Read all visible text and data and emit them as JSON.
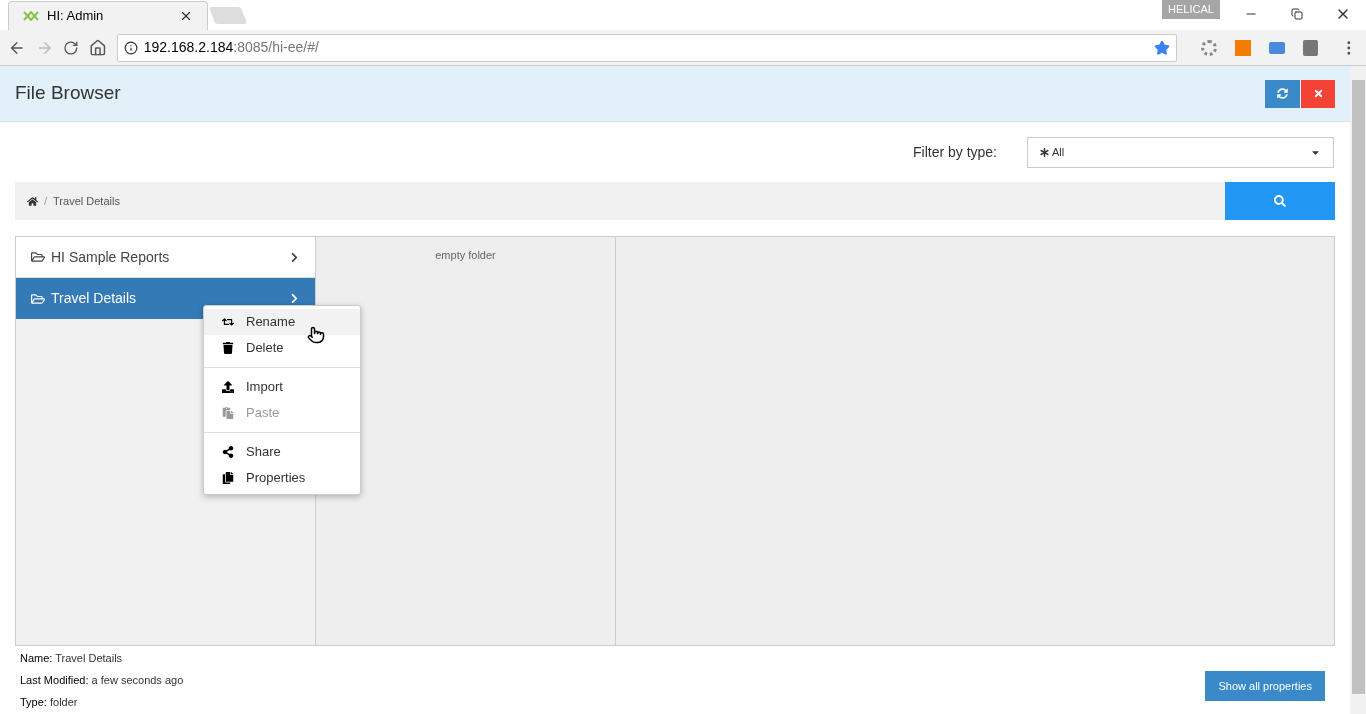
{
  "browser": {
    "tabs": [
      {
        "title": "HI: Admin",
        "selected": true
      }
    ],
    "profile": "HELICAL",
    "address": {
      "host": "192.168.2.184",
      "rest": ":8085/hi-ee/#/"
    }
  },
  "header": {
    "title": "File Browser"
  },
  "filter": {
    "label": "Filter by type:",
    "value": "All"
  },
  "breadcrumb": {
    "separator": "/",
    "items": [
      "Travel Details"
    ]
  },
  "folders": [
    {
      "name": "HI Sample Reports",
      "selected": false
    },
    {
      "name": "Travel Details",
      "selected": true
    }
  ],
  "column_2": {
    "message": "empty folder"
  },
  "context_menu": [
    [
      {
        "label": "Rename",
        "disabled": false,
        "highlighted": true
      },
      {
        "label": "Delete",
        "disabled": false,
        "highlighted": false
      }
    ],
    [
      {
        "label": "Import",
        "disabled": false,
        "highlighted": false
      },
      {
        "label": "Paste",
        "disabled": true,
        "highlighted": false
      }
    ],
    [
      {
        "label": "Share",
        "disabled": false,
        "highlighted": false
      },
      {
        "label": "Properties",
        "disabled": false,
        "highlighted": false
      }
    ]
  ],
  "properties": [
    {
      "label": "Name:",
      "value": "Travel Details"
    },
    {
      "label": "Last Modified:",
      "value": "a few seconds ago"
    },
    {
      "label": "Type:",
      "value": "folder"
    }
  ],
  "show_all_button": "Show all properties"
}
